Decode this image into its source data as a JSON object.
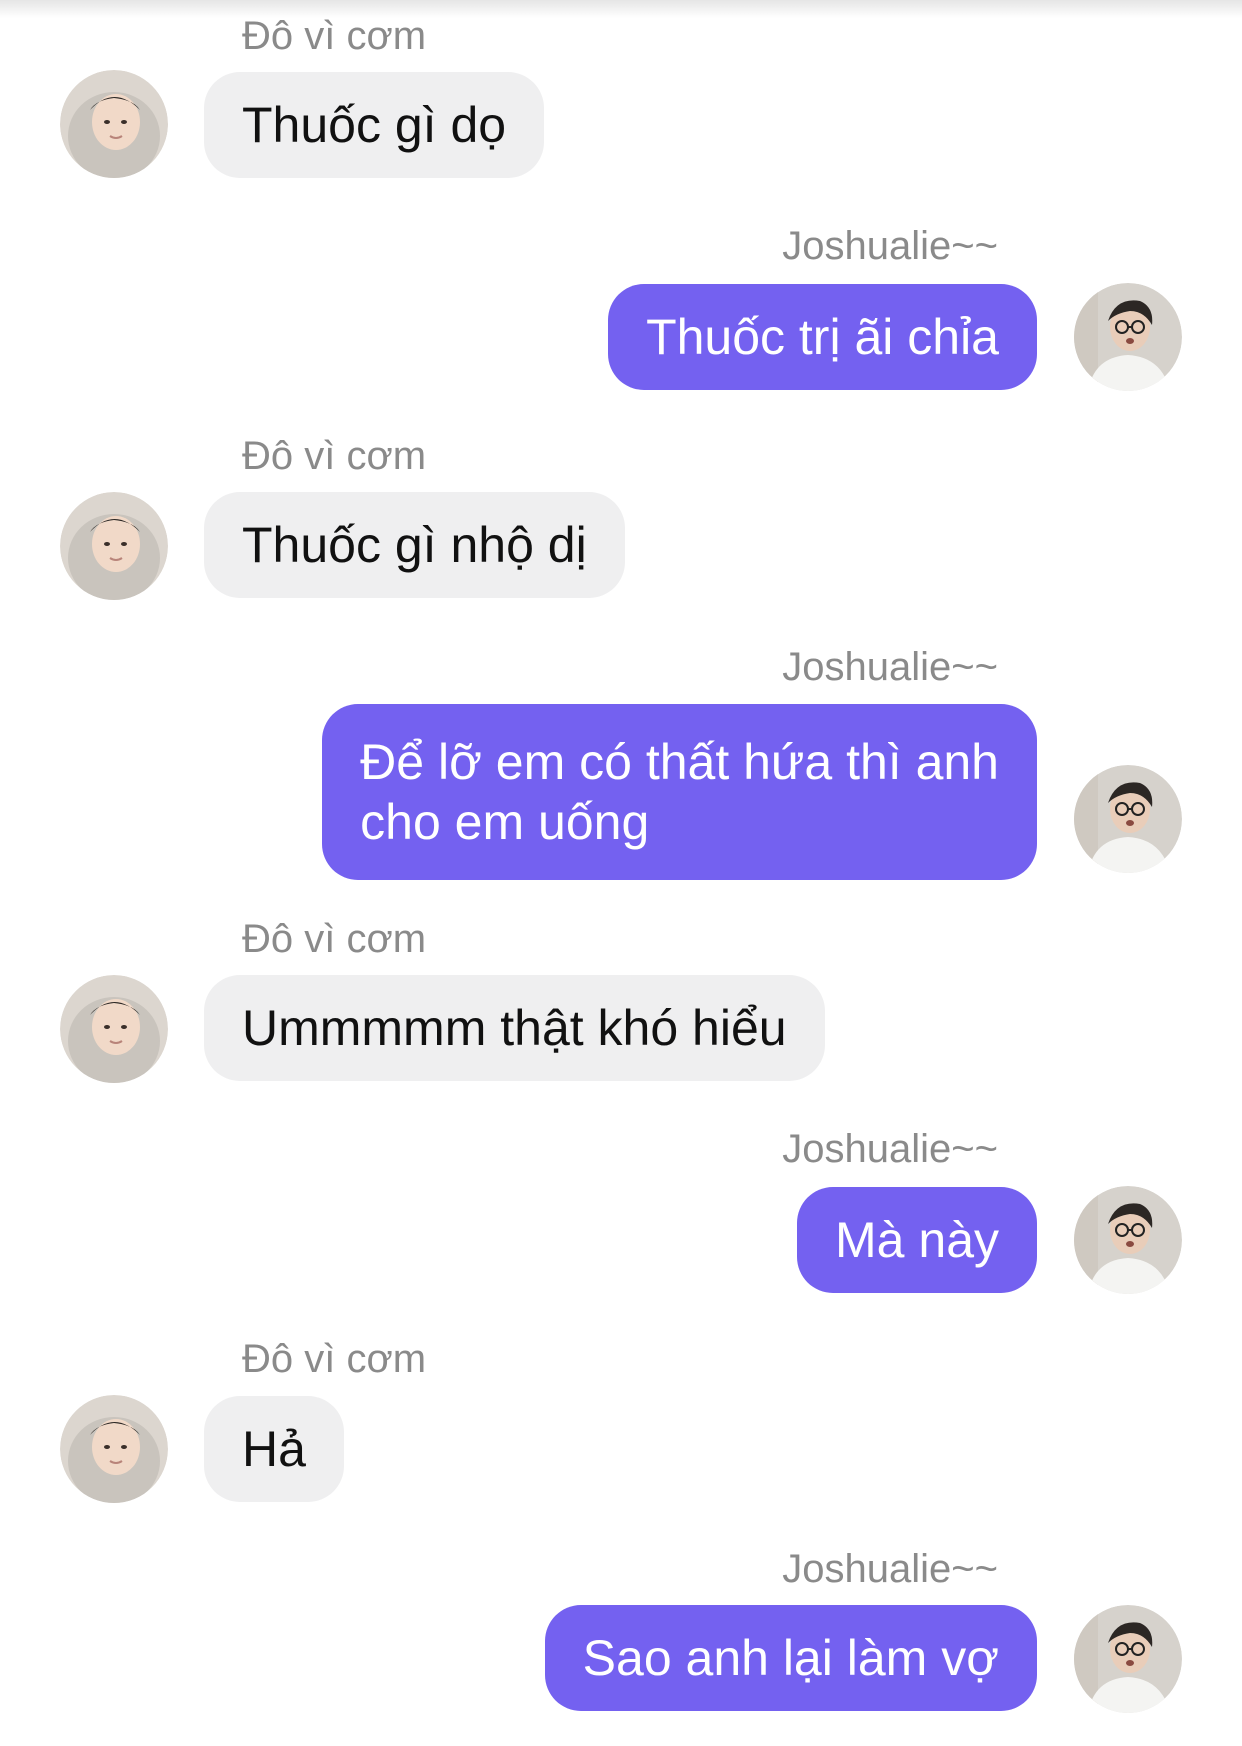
{
  "conversation": {
    "participants": {
      "other": "Đô vì cơm",
      "self": "Joshualie~~"
    },
    "messages": [
      {
        "sender": "Đô vì cơm",
        "text": "Thuốc gì dọ",
        "direction": "incoming"
      },
      {
        "sender": "Joshualie~~",
        "text": "Thuốc trị ãi chỉa",
        "direction": "outgoing"
      },
      {
        "sender": "Đô vì cơm",
        "text": "Thuốc gì nhộ dị",
        "direction": "incoming"
      },
      {
        "sender": "Joshualie~~",
        "text": "Để lỡ em có thất hứa thì anh\ncho em uống",
        "direction": "outgoing"
      },
      {
        "sender": "Đô vì cơm",
        "text": "Ummmmm thật khó hiểu",
        "direction": "incoming"
      },
      {
        "sender": "Joshualie~~",
        "text": "Mà này",
        "direction": "outgoing"
      },
      {
        "sender": "Đô vì cơm",
        "text": "Hả",
        "direction": "incoming"
      },
      {
        "sender": "Joshualie~~",
        "text": "Sao anh lại làm vợ",
        "direction": "outgoing"
      }
    ]
  },
  "colors": {
    "incoming_bubble": "#efeff0",
    "outgoing_bubble": "#7461f0",
    "sender_name": "#8a8a8a"
  }
}
